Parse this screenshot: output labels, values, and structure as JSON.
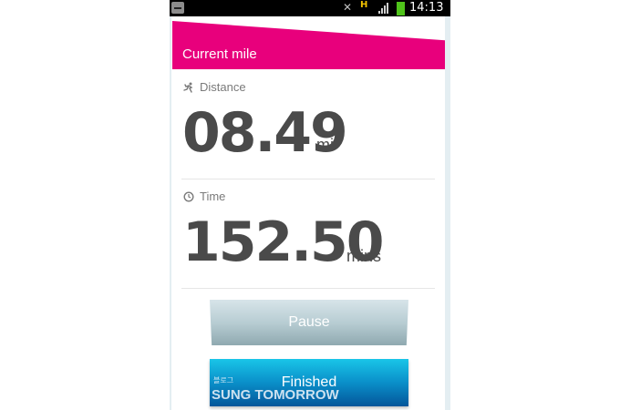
{
  "status_bar": {
    "time": "14:13",
    "network_indicator": "H",
    "icons": [
      "notification-icon",
      "mute-icon",
      "signal-icon",
      "battery-icon"
    ]
  },
  "header": {
    "title": "Current mile",
    "color": "#e8007c"
  },
  "distance": {
    "label": "Distance",
    "value": "08.49",
    "unit": "mi",
    "icon": "runner-icon"
  },
  "time": {
    "label": "Time",
    "value": "152.50",
    "unit": "mins",
    "icon": "clock-icon"
  },
  "buttons": {
    "pause_label": "Pause",
    "finished_label": "Finished"
  },
  "watermark": {
    "small": "블로그",
    "big": "SUNG TOMORROW"
  }
}
